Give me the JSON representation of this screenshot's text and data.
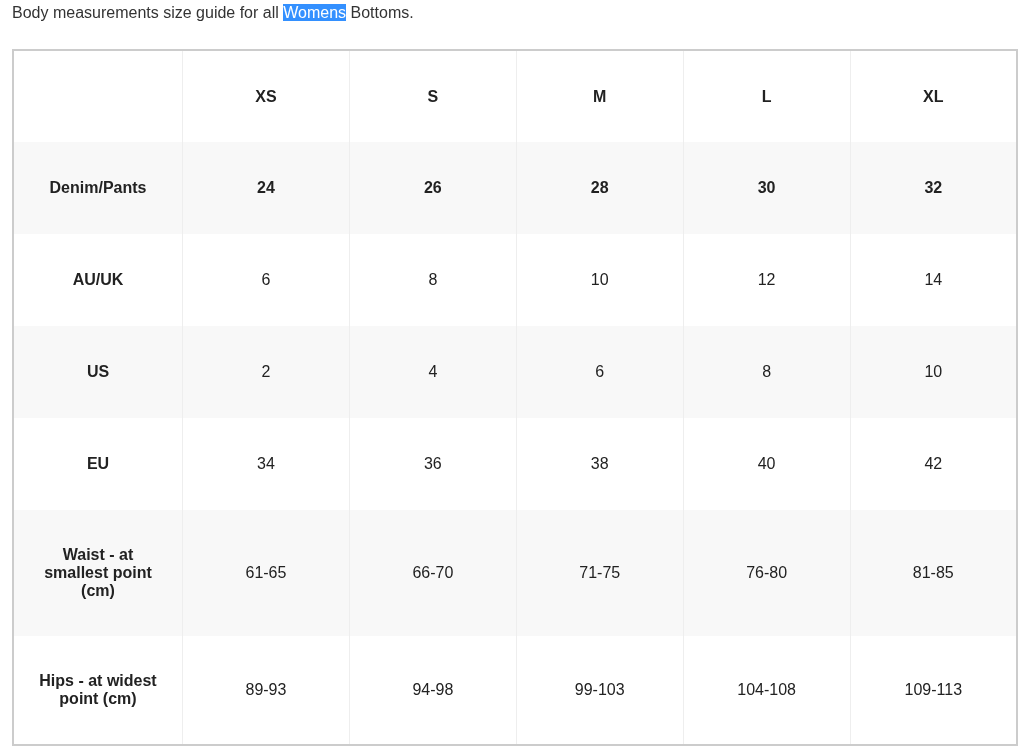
{
  "intro": [
    {
      "text": "Body measurements size guide for all ",
      "selected": false
    },
    {
      "text": "Womens",
      "selected": true
    },
    {
      "text": " Bottoms.",
      "selected": false
    }
  ],
  "table": {
    "columns": [
      "XS",
      "S",
      "M",
      "L",
      "XL"
    ],
    "rows": [
      {
        "label": "Denim/Pants",
        "bold": true,
        "values": [
          "24",
          "26",
          "28",
          "30",
          "32"
        ]
      },
      {
        "label": "AU/UK",
        "bold": false,
        "values": [
          "6",
          "8",
          "10",
          "12",
          "14"
        ]
      },
      {
        "label": "US",
        "bold": false,
        "values": [
          "2",
          "4",
          "6",
          "8",
          "10"
        ]
      },
      {
        "label": "EU",
        "bold": false,
        "values": [
          "34",
          "36",
          "38",
          "40",
          "42"
        ]
      },
      {
        "label": "Waist - at smallest point (cm)",
        "bold": false,
        "values": [
          "61-65",
          "66-70",
          "71-75",
          "76-80",
          "81-85"
        ]
      },
      {
        "label": "Hips - at widest point (cm)",
        "bold": false,
        "values": [
          "89-93",
          "94-98",
          "99-103",
          "104-108",
          "109-113"
        ]
      }
    ]
  }
}
